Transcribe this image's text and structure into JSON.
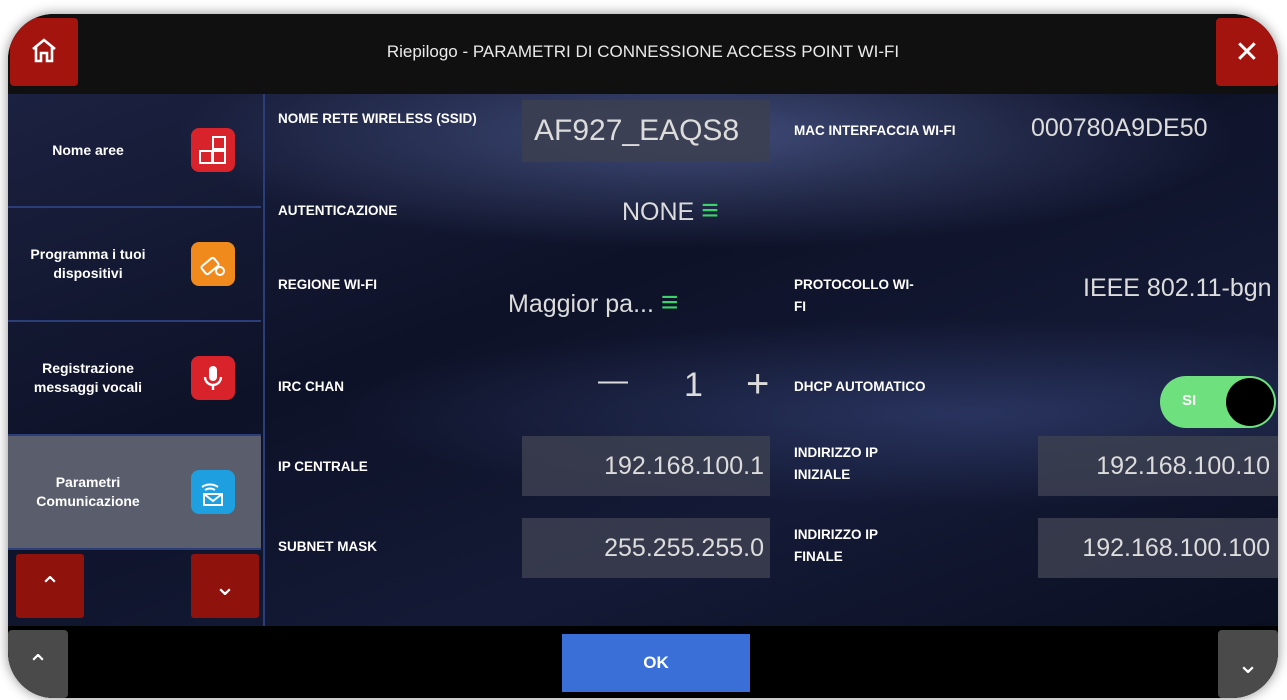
{
  "header": {
    "title": "Riepilogo - PARAMETRI DI CONNESSIONE ACCESS POINT WI-FI",
    "close_symbol": "✕"
  },
  "sidebar": {
    "items": [
      {
        "label": "Nome aree",
        "icon": "numbered-grid-icon",
        "color": "#d8232a"
      },
      {
        "label": "Programma i tuoi dispositivi",
        "icon": "devices-icon",
        "color": "#f08a1d"
      },
      {
        "label": "Registrazione messaggi vocali",
        "icon": "microphone-icon",
        "color": "#d8232a"
      },
      {
        "label": "Parametri Comunicazione",
        "icon": "wifi-envelope-icon",
        "color": "#1d9fe0"
      }
    ],
    "up_symbol": "⌃",
    "down_symbol": "⌄"
  },
  "fields": {
    "ssid": {
      "label": "NOME RETE WIRELESS (SSID)",
      "value": "AF927_EAQS8"
    },
    "mac": {
      "label": "MAC INTERFACCIA WI-FI",
      "value": "000780A9DE50"
    },
    "auth": {
      "label": "AUTENTICAZIONE",
      "value": "NONE"
    },
    "region": {
      "label": "REGIONE WI-FI",
      "value": "Maggior pa..."
    },
    "protocol": {
      "label": "PROTOCOLLO WI-FI",
      "value": "IEEE 802.11-bgn"
    },
    "irc_chan": {
      "label": "IRC CHAN",
      "value": "1",
      "minus": "—",
      "plus": "+"
    },
    "dhcp": {
      "label": "DHCP AUTOMATICO",
      "value": "SI"
    },
    "ip_central": {
      "label": "IP CENTRALE",
      "value": "192.168.100.1"
    },
    "ip_start": {
      "label": "INDIRIZZO IP INIZIALE",
      "value": "192.168.100.10"
    },
    "subnet": {
      "label": "SUBNET MASK",
      "value": "255.255.255.0"
    },
    "ip_end": {
      "label": "INDIRIZZO IP FINALE",
      "value": "192.168.100.100"
    }
  },
  "footer": {
    "ok_label": "OK",
    "left_symbol": "⌃",
    "right_symbol": "⌄"
  },
  "colors": {
    "accent_red": "#a3140e",
    "ok_blue": "#3a6fd8",
    "toggle_green": "#6fe07e",
    "menu_green": "#3ed36a"
  }
}
